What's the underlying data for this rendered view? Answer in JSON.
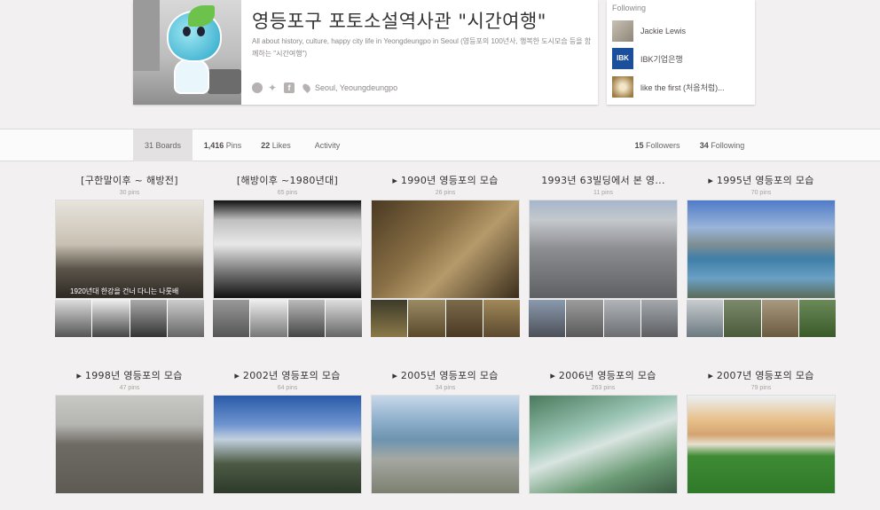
{
  "profile": {
    "name": "영등포구 포토소설역사관 \"시간여행\"",
    "about": "All about history, culture, happy city life in Yeongdeungpo in Seoul (영등포의 100년사, 행복한 도시모습 등을 함께하는 \"시간여행\")",
    "location": "Seoul, Yeoungdeungpo",
    "icons": [
      "globe-icon",
      "twitter-icon",
      "facebook-icon",
      "location-pin-icon"
    ]
  },
  "following_widget": {
    "title": "Following",
    "users": [
      {
        "name": "Jackie Lewis"
      },
      {
        "name": "IBK기업은행"
      },
      {
        "name": "like the first (처음처럼)..."
      }
    ]
  },
  "nav": {
    "boards": {
      "count": "31",
      "label": "Boards"
    },
    "pins": {
      "count": "1,416",
      "label": "Pins"
    },
    "likes": {
      "count": "22",
      "label": "Likes"
    },
    "activity": {
      "label": "Activity"
    },
    "followers": {
      "count": "15",
      "label": "Followers"
    },
    "following": {
      "count": "34",
      "label": "Following"
    }
  },
  "boards": [
    {
      "title": "[구한말이후 ~ 해방전]",
      "pins": "30 pins",
      "caption": "1920년대 한강을 건너 다니는 나룻배"
    },
    {
      "title": "[해방이후 ~1980년대]",
      "pins": "65 pins",
      "caption": ""
    },
    {
      "title": "▸ 1990년 영등포의 모습",
      "pins": "26 pins",
      "caption": ""
    },
    {
      "title": "1993년 63빌딩에서 본 영...",
      "pins": "11 pins",
      "caption": ""
    },
    {
      "title": "▸ 1995년 영등포의 모습",
      "pins": "70 pins",
      "caption": ""
    },
    {
      "title": "▸ 1998년 영등포의 모습",
      "pins": "47 pins",
      "caption": ""
    },
    {
      "title": "▸ 2002년 영등포의 모습",
      "pins": "64 pins",
      "caption": ""
    },
    {
      "title": "▸ 2005년 영등포의 모습",
      "pins": "34 pins",
      "caption": ""
    },
    {
      "title": "▸ 2006년 영등포의 모습",
      "pins": "263 pins",
      "caption": ""
    },
    {
      "title": "▸ 2007년 영등포의 모습",
      "pins": "79 pins",
      "caption": ""
    }
  ],
  "colors": {
    "page_bg": "#f2f0f0",
    "card_bg": "#ffffff",
    "active_tab": "#e3e1e1",
    "text": "#524d4d",
    "muted": "#a8a3a3"
  }
}
